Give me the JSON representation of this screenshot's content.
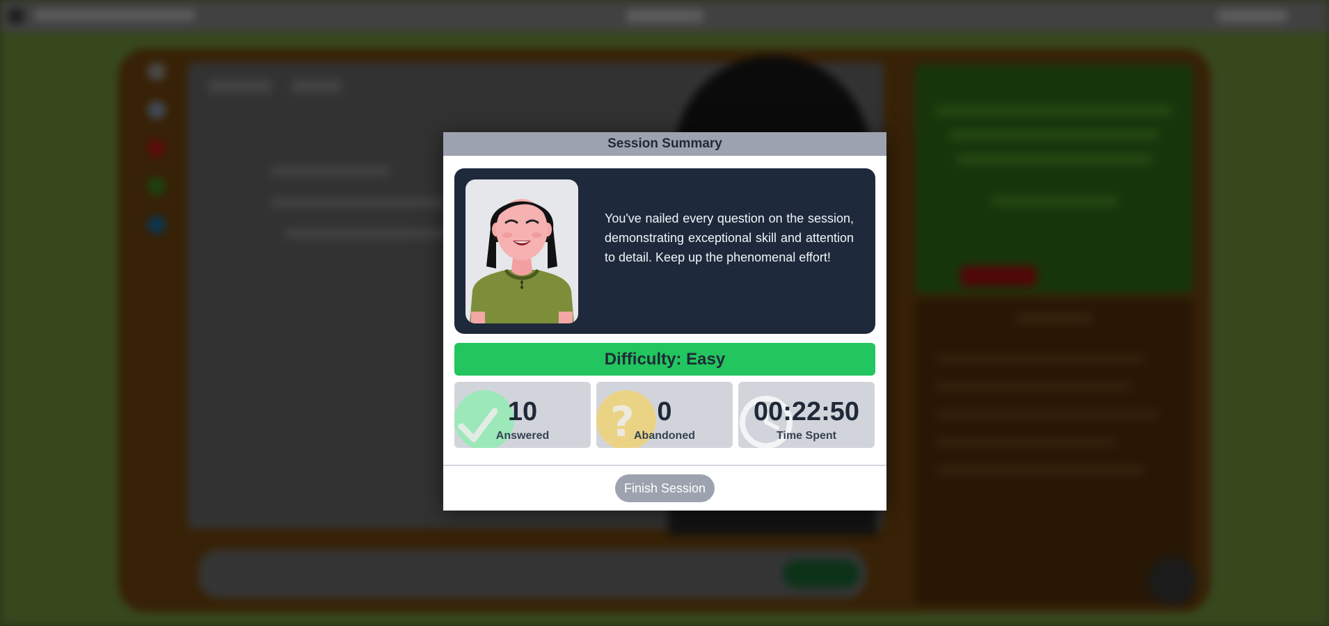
{
  "modal": {
    "title": "Session Summary",
    "message": "You've nailed every question on the session, demonstrating exceptional skill and attention to detail. Keep up the phenomenal effort!",
    "difficulty": "Difficulty: Easy",
    "stats": [
      {
        "value": "10",
        "label": "Answered",
        "icon": "check-icon",
        "color": "#86efac"
      },
      {
        "value": "0",
        "label": "Abandoned",
        "icon": "question-icon",
        "color": "#fcd34d"
      },
      {
        "value": "00:22:50",
        "label": "Time Spent",
        "icon": "clock-icon",
        "color": "#f3f4f6"
      }
    ],
    "finish_label": "Finish Session"
  },
  "colors": {
    "header": "#9ca3af",
    "hero_bg": "#1e293b",
    "difficulty_bg": "#22c55e",
    "stat_bg": "#d1d5db",
    "button_bg": "#9ca3af"
  }
}
